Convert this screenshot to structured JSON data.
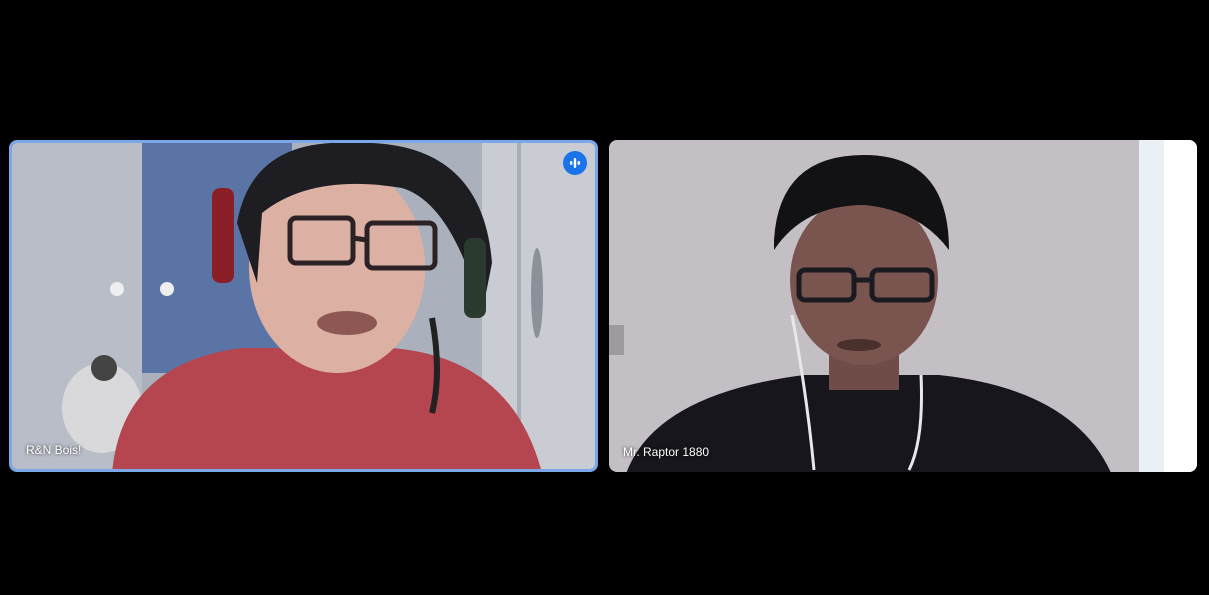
{
  "participants": [
    {
      "name": "R&N Bois!",
      "speaking": true
    },
    {
      "name": "Mr. Raptor 1880",
      "speaking": false
    }
  ],
  "colors": {
    "active_border": "#7aa7e8",
    "speaking_badge": "#1a73e8",
    "background": "#000000"
  },
  "icons": {
    "speaking": "audio-level-icon"
  }
}
